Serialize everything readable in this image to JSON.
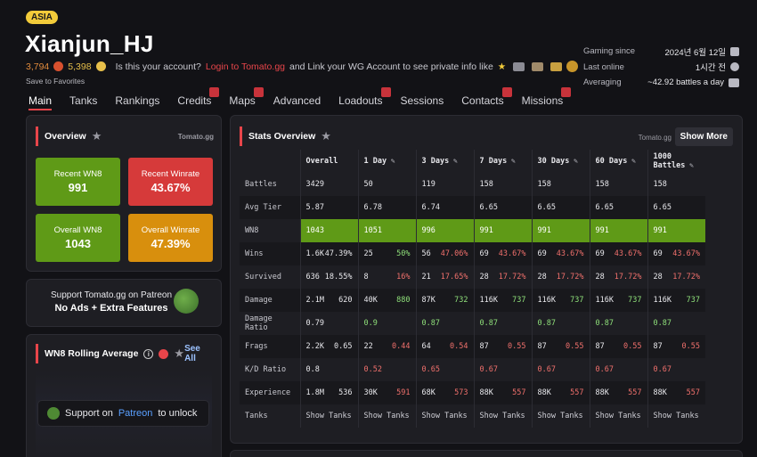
{
  "header": {
    "region": "ASIA",
    "player_name": "Xianjun_HJ",
    "rating": "3,794",
    "gold": "5,398",
    "account_prompt": "Is this your account?",
    "login_link": "Login to Tomato.gg",
    "account_suffix": "and Link your WG Account to see private info like",
    "save_favorites": "Save to Favorites"
  },
  "right_info": {
    "gaming_since_label": "Gaming since",
    "gaming_since_value": "2024년 6월 12일",
    "last_online_label": "Last online",
    "last_online_value": "1시간 전",
    "averaging_label": "Averaging",
    "averaging_value": "~42.92 battles a day"
  },
  "nav": {
    "items": [
      {
        "label": "Main",
        "active": true,
        "locked": false
      },
      {
        "label": "Tanks",
        "active": false,
        "locked": false
      },
      {
        "label": "Rankings",
        "active": false,
        "locked": false
      },
      {
        "label": "Credits",
        "active": false,
        "locked": true
      },
      {
        "label": "Maps",
        "active": false,
        "locked": true
      },
      {
        "label": "Advanced",
        "active": false,
        "locked": false
      },
      {
        "label": "Loadouts",
        "active": false,
        "locked": true
      },
      {
        "label": "Sessions",
        "active": false,
        "locked": false
      },
      {
        "label": "Contacts",
        "active": false,
        "locked": true
      },
      {
        "label": "Missions",
        "active": false,
        "locked": true
      }
    ]
  },
  "overview": {
    "title": "Overview",
    "brand": "Tomato.gg",
    "boxes": [
      {
        "label": "Recent WN8",
        "value": "991",
        "color": "#5f9a17"
      },
      {
        "label": "Recent Winrate",
        "value": "43.67%",
        "color": "#d63a3a"
      },
      {
        "label": "Overall WN8",
        "value": "1043",
        "color": "#5f9a17"
      },
      {
        "label": "Overall Winrate",
        "value": "47.39%",
        "color": "#d88f0d"
      }
    ]
  },
  "patreon_card": {
    "line1": "Support Tomato.gg on Patreon",
    "line2": "No Ads + Extra Features"
  },
  "rolling": {
    "title": "WN8 Rolling Average",
    "see_all": "See All",
    "unlock_prefix": "Support on",
    "unlock_link": "Patreon",
    "unlock_suffix": "to unlock"
  },
  "stats": {
    "title": "Stats Overview",
    "brand": "Tomato.gg",
    "show_more": "Show More",
    "columns": [
      "Overall",
      "1 Day",
      "3 Days",
      "7 Days",
      "30 Days",
      "60 Days",
      "1000 Battles"
    ],
    "rows": [
      {
        "label": "Battles",
        "cells": [
          [
            "3429",
            ""
          ],
          [
            "50",
            ""
          ],
          [
            "119",
            ""
          ],
          [
            "158",
            ""
          ],
          [
            "158",
            ""
          ],
          [
            "158",
            ""
          ],
          [
            "158",
            ""
          ]
        ]
      },
      {
        "label": "Avg Tier",
        "cells": [
          [
            "5.87",
            ""
          ],
          [
            "6.78",
            ""
          ],
          [
            "6.74",
            ""
          ],
          [
            "6.65",
            ""
          ],
          [
            "6.65",
            ""
          ],
          [
            "6.65",
            ""
          ],
          [
            "6.65",
            ""
          ]
        ]
      },
      {
        "label": "WN8",
        "cells": [
          [
            "1043",
            ""
          ],
          [
            "1051",
            ""
          ],
          [
            "996",
            ""
          ],
          [
            "991",
            ""
          ],
          [
            "991",
            ""
          ],
          [
            "991",
            ""
          ],
          [
            "991",
            ""
          ]
        ]
      },
      {
        "label": "Wins",
        "cells": [
          [
            "1.6K",
            "47.39%"
          ],
          [
            "25",
            "50%"
          ],
          [
            "56",
            "47.06%"
          ],
          [
            "69",
            "43.67%"
          ],
          [
            "69",
            "43.67%"
          ],
          [
            "69",
            "43.67%"
          ],
          [
            "69",
            "43.67%"
          ]
        ]
      },
      {
        "label": "Survived",
        "cells": [
          [
            "636",
            "18.55%"
          ],
          [
            "8",
            "16%"
          ],
          [
            "21",
            "17.65%"
          ],
          [
            "28",
            "17.72%"
          ],
          [
            "28",
            "17.72%"
          ],
          [
            "28",
            "17.72%"
          ],
          [
            "28",
            "17.72%"
          ]
        ]
      },
      {
        "label": "Damage",
        "cells": [
          [
            "2.1M",
            "620"
          ],
          [
            "40K",
            "880"
          ],
          [
            "87K",
            "732"
          ],
          [
            "116K",
            "737"
          ],
          [
            "116K",
            "737"
          ],
          [
            "116K",
            "737"
          ],
          [
            "116K",
            "737"
          ]
        ]
      },
      {
        "label": "Damage Ratio",
        "cells": [
          [
            "0.79",
            ""
          ],
          [
            "0.9",
            ""
          ],
          [
            "0.87",
            ""
          ],
          [
            "0.87",
            ""
          ],
          [
            "0.87",
            ""
          ],
          [
            "0.87",
            ""
          ],
          [
            "0.87",
            ""
          ]
        ]
      },
      {
        "label": "Frags",
        "cells": [
          [
            "2.2K",
            "0.65"
          ],
          [
            "22",
            "0.44"
          ],
          [
            "64",
            "0.54"
          ],
          [
            "87",
            "0.55"
          ],
          [
            "87",
            "0.55"
          ],
          [
            "87",
            "0.55"
          ],
          [
            "87",
            "0.55"
          ]
        ]
      },
      {
        "label": "K/D Ratio",
        "cells": [
          [
            "0.8",
            ""
          ],
          [
            "0.52",
            ""
          ],
          [
            "0.65",
            ""
          ],
          [
            "0.67",
            ""
          ],
          [
            "0.67",
            ""
          ],
          [
            "0.67",
            ""
          ],
          [
            "0.67",
            ""
          ]
        ]
      },
      {
        "label": "Experience",
        "cells": [
          [
            "1.8M",
            "536"
          ],
          [
            "30K",
            "591"
          ],
          [
            "68K",
            "573"
          ],
          [
            "88K",
            "557"
          ],
          [
            "88K",
            "557"
          ],
          [
            "88K",
            "557"
          ],
          [
            "88K",
            "557"
          ]
        ]
      },
      {
        "label": "Tanks",
        "cells": [
          [
            "Show Tanks",
            ""
          ],
          [
            "Show Tanks",
            ""
          ],
          [
            "Show Tanks",
            ""
          ],
          [
            "Show Tanks",
            ""
          ],
          [
            "Show Tanks",
            ""
          ],
          [
            "Show Tanks",
            ""
          ],
          [
            "Show Tanks",
            ""
          ]
        ]
      }
    ]
  }
}
